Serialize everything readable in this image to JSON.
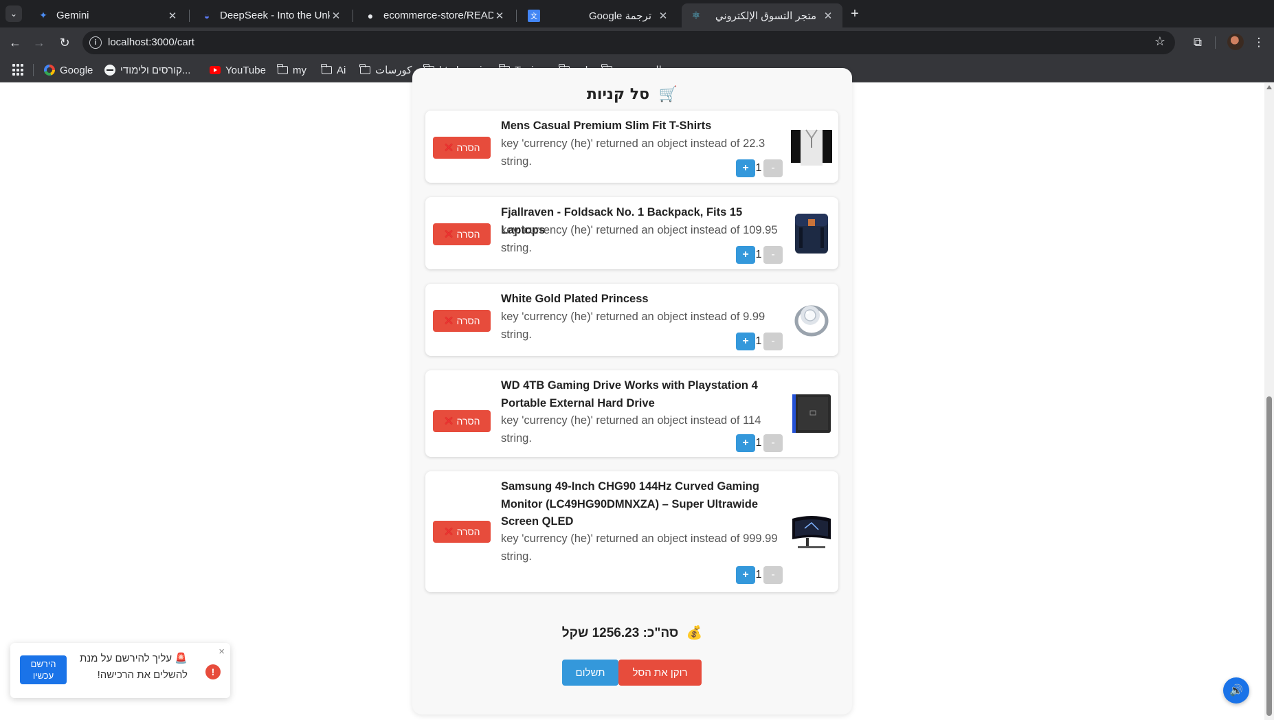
{
  "browser": {
    "tabs": [
      {
        "title": "Gemini",
        "favicon": "gemini-sparkle-icon"
      },
      {
        "title": "DeepSeek - Into the Unknown",
        "favicon": "deepseek-whale-icon"
      },
      {
        "title": "ecommerce-store/README",
        "favicon": "github-icon"
      },
      {
        "title": "Google ترجمة",
        "favicon": "google-translate-icon"
      },
      {
        "title": "متجر التسوق الإلكتروني",
        "favicon": "react-icon",
        "active": true
      }
    ],
    "url": "localhost:3000/cart",
    "bookmarks": [
      {
        "label": "Google",
        "icon": "google-icon"
      },
      {
        "label": "קורסים ולימודי...",
        "icon": "circle-icon"
      },
      {
        "label": "YouTube",
        "icon": "youtube-icon"
      },
      {
        "label": "my",
        "icon": "folder-icon"
      },
      {
        "label": "Ai",
        "icon": "folder-icon"
      },
      {
        "label": "كورسات",
        "icon": "folder-icon"
      },
      {
        "label": "html css js",
        "icon": "folder-icon"
      },
      {
        "label": "Typing",
        "icon": "folder-icon"
      },
      {
        "label": "sql",
        "icon": "folder-icon"
      },
      {
        "label": "المستوردة",
        "icon": "folder-icon"
      }
    ]
  },
  "cart": {
    "title": "סל קניות",
    "title_icon": "shopping-cart-icon",
    "items": [
      {
        "name": "Mens Casual Premium Slim Fit T-Shirts",
        "desc": "key 'currency (he)' returned an object instead of 22.3 string.",
        "qty": "1",
        "plus": "+",
        "minus": "-",
        "remove": "הסרה",
        "image": "tshirt-image"
      },
      {
        "name": "Fjallraven - Foldsack No. 1 Backpack, Fits 15 Laptops",
        "desc": "key 'currency (he)' returned an object instead of 109.95 string.",
        "qty": "1",
        "plus": "+",
        "minus": "-",
        "remove": "הסרה",
        "image": "backpack-image"
      },
      {
        "name": "White Gold Plated Princess",
        "desc": "key 'currency (he)' returned an object instead of 9.99 string.",
        "qty": "1",
        "plus": "+",
        "minus": "-",
        "remove": "הסרה",
        "image": "ring-image"
      },
      {
        "name": "WD 4TB Gaming Drive Works with Playstation 4 Portable External Hard Drive",
        "desc": "key 'currency (he)' returned an object instead of 114 string.",
        "qty": "1",
        "plus": "+",
        "minus": "-",
        "remove": "הסרה",
        "image": "hard-drive-image"
      },
      {
        "name": "Samsung 49-Inch CHG90 144Hz Curved Gaming Monitor (LC49HG90DMNXZA) – Super Ultrawide Screen QLED",
        "desc": "key 'currency (he)' returned an object instead of 999.99 string.",
        "qty": "1",
        "plus": "+",
        "minus": "-",
        "remove": "הסרה",
        "image": "monitor-image"
      }
    ],
    "total_text": "סה\"כ: 1256.23 שקל",
    "pay_label": "תשלום",
    "clear_label": "רוקן את הסל"
  },
  "toast": {
    "message": "עליך להירשם על מנת להשלים את הרכישה!",
    "register_label": "הירשם עכשיו",
    "close": "×",
    "alert": "!"
  },
  "colors": {
    "danger": "#e74c3c",
    "primary": "#3498db",
    "register": "#1a73e8"
  }
}
